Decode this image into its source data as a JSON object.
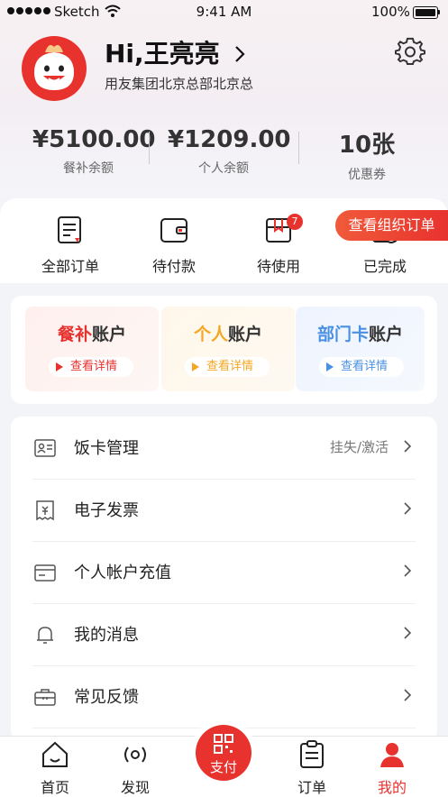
{
  "status_bar": {
    "carrier": "Sketch",
    "time": "9:41 AM",
    "battery": "100%"
  },
  "profile": {
    "greeting": "Hi,王亮亮",
    "organization": "用友集团北京总部北京总"
  },
  "balances": [
    {
      "value": "¥5100.00",
      "label": "餐补余额"
    },
    {
      "value": "¥1209.00",
      "label": "个人余额"
    },
    {
      "value": "10张",
      "label": "优惠券"
    }
  ],
  "orders": {
    "items": [
      {
        "label": "全部订单",
        "icon": "order-list-icon"
      },
      {
        "label": "待付款",
        "icon": "wallet-icon"
      },
      {
        "label": "待使用",
        "icon": "box-icon"
      },
      {
        "label": "已完成",
        "icon": "completed-icon"
      }
    ],
    "pending_use_badge": "7",
    "org_orders_button": "查看组织订单"
  },
  "accounts": [
    {
      "title_accent": "餐补",
      "title_rest": "账户",
      "action": "查看详情",
      "accent": "#e8322e"
    },
    {
      "title_accent": "个人",
      "title_rest": "账户",
      "action": "查看详情",
      "accent": "#f5a623"
    },
    {
      "title_accent": "部门卡",
      "title_rest": "账户",
      "action": "查看详情",
      "accent": "#4a90e2"
    }
  ],
  "menu": [
    {
      "label": "饭卡管理",
      "hint": "挂失/激活",
      "icon": "id-card-icon"
    },
    {
      "label": "电子发票",
      "hint": "",
      "icon": "invoice-icon"
    },
    {
      "label": "个人帐户充值",
      "hint": "",
      "icon": "card-icon"
    },
    {
      "label": "我的消息",
      "hint": "",
      "icon": "bell-icon"
    },
    {
      "label": "常见反馈",
      "hint": "",
      "icon": "briefcase-icon"
    }
  ],
  "tabbar": {
    "home": "首页",
    "discover": "发现",
    "pay": "支付",
    "orders": "订单",
    "mine": "我的",
    "active_color": "#e8322e"
  }
}
